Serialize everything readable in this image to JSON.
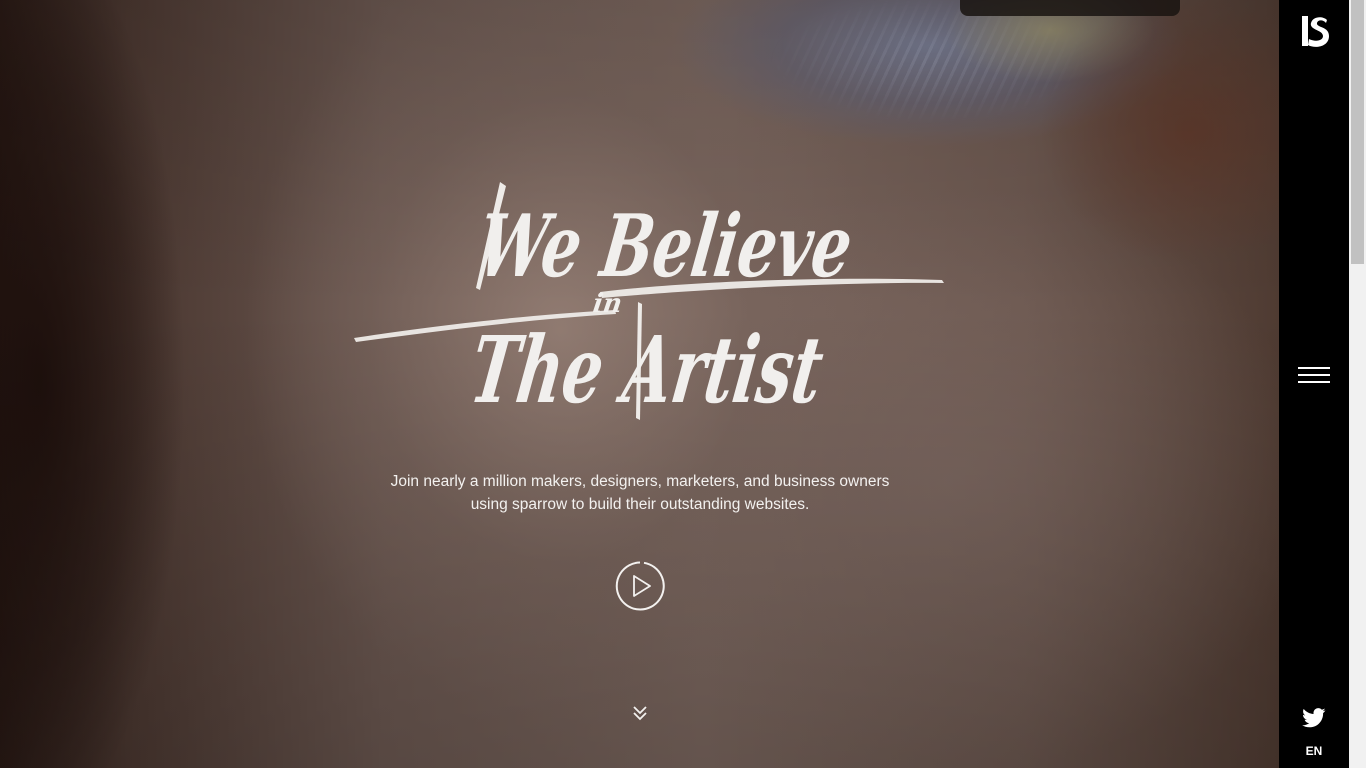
{
  "hero": {
    "headline": {
      "line1": "We Believe",
      "connector": "in",
      "line2": "The Artist"
    },
    "tagline_line1": "Join nearly a million makers, designers, marketers, and business owners",
    "tagline_line2": "using sparrow to build their outstanding websites."
  },
  "sidebar": {
    "language": "EN"
  },
  "colors": {
    "sidebar_bg": "#000000",
    "text": "#f1efed"
  },
  "icons": {
    "logo": "sparrow-logo-icon",
    "menu": "hamburger-menu-icon",
    "play": "play-icon",
    "scroll": "double-chevron-down-icon",
    "social": "twitter-icon"
  }
}
